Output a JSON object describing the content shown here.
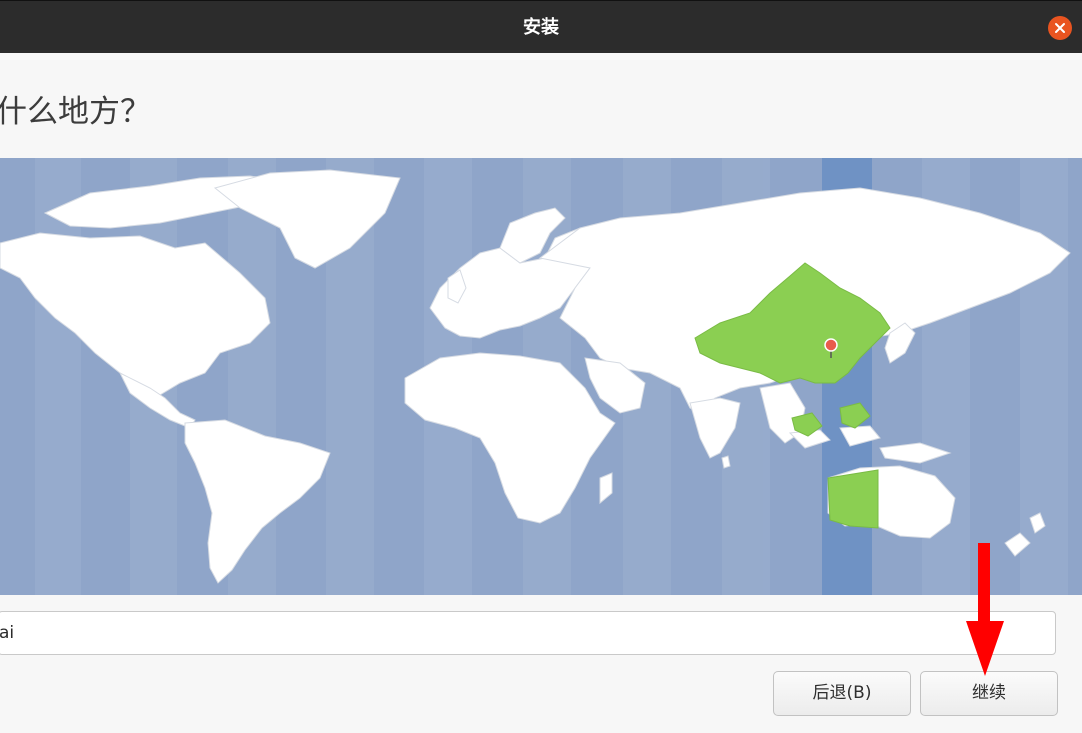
{
  "window": {
    "title": "安装",
    "close_icon": "close-icon"
  },
  "page": {
    "heading": "什么地方？"
  },
  "map": {
    "selected_region_color": "#8bcf52",
    "timezone_band_color": "#6f92c4",
    "ocean_color": "#8fa5c9",
    "land_color": "#ffffff",
    "marker_icon": "location-pin-icon"
  },
  "location_field": {
    "value": "ai"
  },
  "buttons": {
    "back_label": "后退(B)",
    "continue_label": "继续"
  },
  "annotation": {
    "arrow_color": "#ff0000",
    "arrow_icon": "down-arrow-icon"
  }
}
